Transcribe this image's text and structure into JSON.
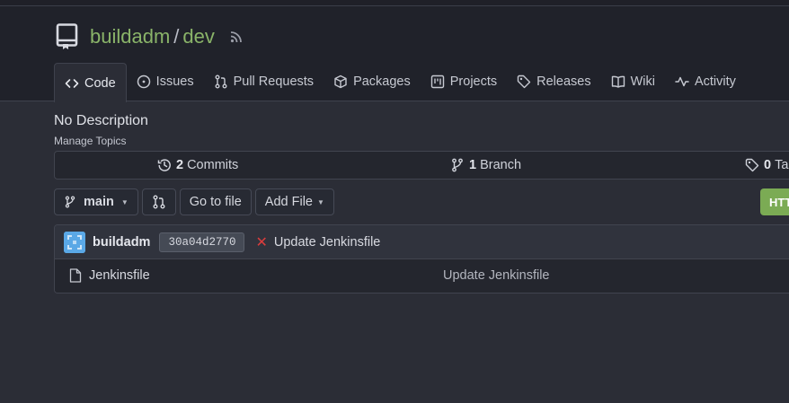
{
  "repo": {
    "owner": "buildadm",
    "separator": "/",
    "name": "dev"
  },
  "tabs": [
    {
      "label": "Code",
      "icon": "code-icon",
      "active": true
    },
    {
      "label": "Issues",
      "icon": "issue-icon"
    },
    {
      "label": "Pull Requests",
      "icon": "pull-request-icon"
    },
    {
      "label": "Packages",
      "icon": "package-icon"
    },
    {
      "label": "Projects",
      "icon": "project-icon"
    },
    {
      "label": "Releases",
      "icon": "tag-icon"
    },
    {
      "label": "Wiki",
      "icon": "book-icon"
    },
    {
      "label": "Activity",
      "icon": "pulse-icon"
    }
  ],
  "description": "No Description",
  "manage_topics": "Manage Topics",
  "stats": {
    "commits": {
      "count": "2",
      "label": "Commits"
    },
    "branches": {
      "count": "1",
      "label": "Branch"
    },
    "tags": {
      "count": "0",
      "label": "Tags"
    }
  },
  "toolbar": {
    "branch": "main",
    "go_to_file": "Go to file",
    "add_file": "Add File",
    "clone": "HTTPS"
  },
  "latest_commit": {
    "author": "buildadm",
    "sha": "30a04d2770",
    "status": "failure",
    "message": "Update Jenkinsfile"
  },
  "files": [
    {
      "name": "Jenkinsfile",
      "commit_message": "Update Jenkinsfile",
      "type": "file"
    }
  ],
  "colors": {
    "accent": "#8ab469",
    "clone_button": "#7bab54",
    "status_fail": "#db3d3d",
    "background": "#2b2d36",
    "header": "#20222a"
  }
}
